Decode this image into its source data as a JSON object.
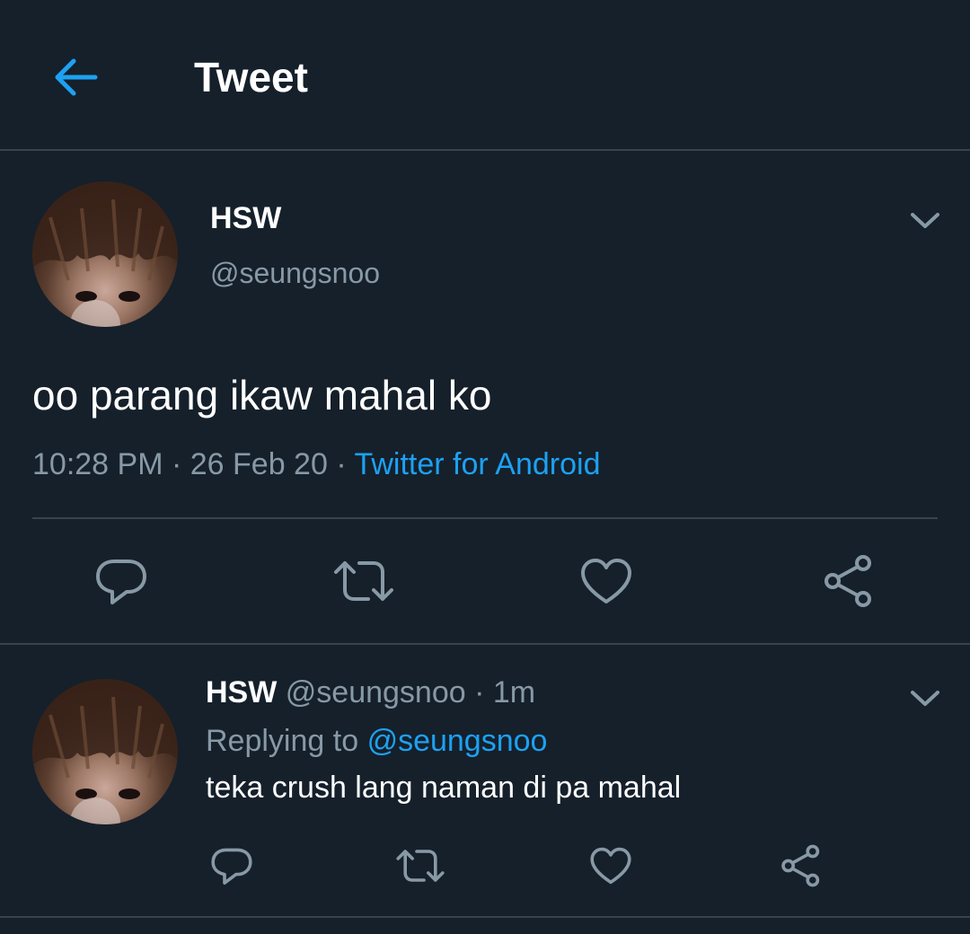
{
  "header": {
    "title": "Tweet",
    "back_icon": "arrow-left-icon",
    "accent_color": "#1da1f2"
  },
  "tweet": {
    "author_name": "HSW",
    "author_handle": "@seungsnoo",
    "text": "oo parang ikaw mahal ko",
    "time": "10:28 PM",
    "sep1": " · ",
    "date": "26 Feb 20",
    "sep2": " · ",
    "source": "Twitter for Android",
    "menu_icon": "chevron-down-icon",
    "actions": [
      "reply-icon",
      "retweet-icon",
      "like-icon",
      "share-icon"
    ]
  },
  "reply": {
    "author_name": "HSW",
    "author_handle": "@seungsnoo",
    "separator": " · ",
    "time_ago": "1m",
    "replying_to_label": "Replying to",
    "replying_to_handle": "@seungsnoo",
    "text": "teka crush lang naman di pa mahal",
    "menu_icon": "chevron-down-icon",
    "actions": [
      "reply-icon",
      "retweet-icon",
      "like-icon",
      "share-icon"
    ]
  },
  "colors": {
    "background": "#15202b",
    "divider": "#38444d",
    "secondary_text": "#8899a6",
    "icon": "#8899a6",
    "link": "#1da1f2"
  }
}
